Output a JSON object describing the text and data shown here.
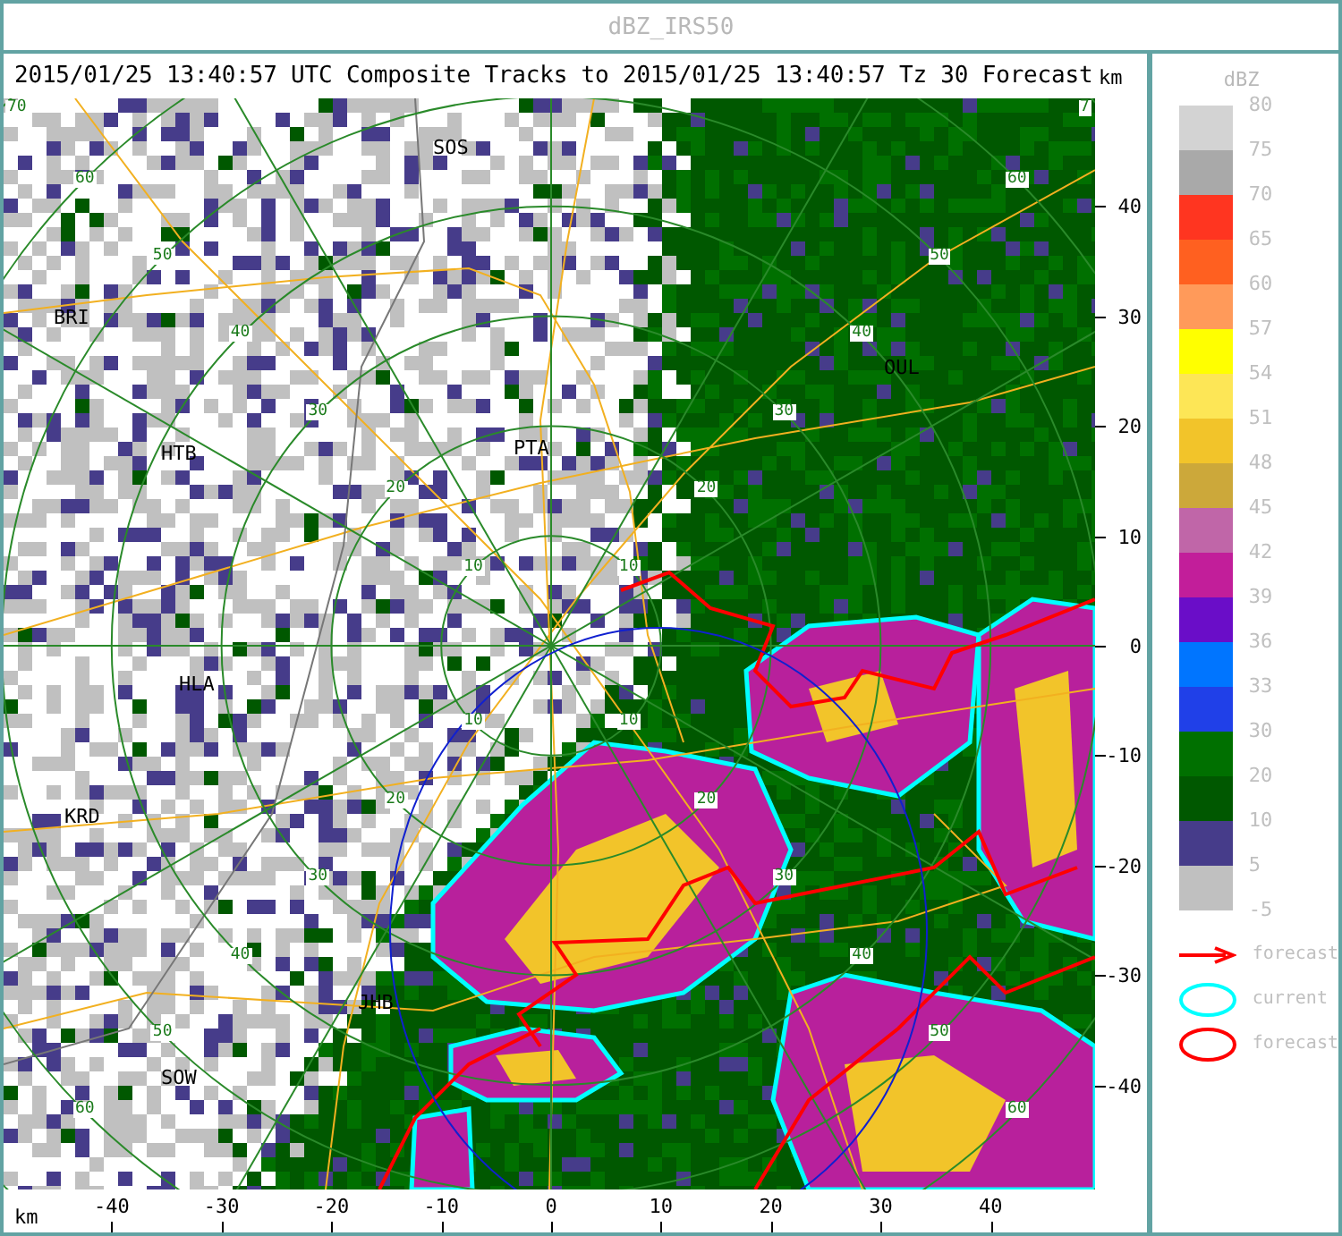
{
  "window": {
    "title": "dBZ_IRS50"
  },
  "header": "2015/01/25 13:40:57 UTC Composite Tracks to 2015/01/25 13:40:57 Tz 30 Forecast",
  "map": {
    "cities": [
      {
        "name": "SOS"
      },
      {
        "name": "BRI"
      },
      {
        "name": "HTB"
      },
      {
        "name": "PTA"
      },
      {
        "name": "OUL"
      },
      {
        "name": "HLA"
      },
      {
        "name": "KRD"
      },
      {
        "name": "JHB"
      },
      {
        "name": "SOW"
      }
    ],
    "ring_labels": [
      {
        "kind": "nw",
        "labels": [
          "10",
          "20",
          "30",
          "40",
          "50",
          "60",
          "70"
        ]
      },
      {
        "kind": "ne",
        "labels": [
          "10",
          "20",
          "30",
          "40",
          "50",
          "60",
          "7"
        ]
      },
      {
        "kind": "sw",
        "labels": [
          "10",
          "20",
          "30",
          "40",
          "50",
          "60"
        ]
      },
      {
        "kind": "se",
        "labels": [
          "10",
          "20",
          "30",
          "40",
          "50",
          "60"
        ]
      }
    ]
  },
  "y_axis": {
    "unit": "km",
    "ticks": [
      "40",
      "30",
      "20",
      "10",
      "0",
      "-10",
      "-20",
      "-30",
      "-40"
    ]
  },
  "x_axis": {
    "unit": "km",
    "ticks": [
      "-40",
      "-30",
      "-20",
      "-10",
      "0",
      "10",
      "20",
      "30",
      "40"
    ]
  },
  "legend": {
    "title": "dBZ",
    "top_label": "80",
    "bins": [
      {
        "color": "#d3d3d3",
        "label": "75"
      },
      {
        "color": "#a9a9a9",
        "label": "70"
      },
      {
        "color": "#ff3520",
        "label": "65"
      },
      {
        "color": "#ff6020",
        "label": "60"
      },
      {
        "color": "#ff9a5a",
        "label": "57"
      },
      {
        "color": "#ffff00",
        "label": "54"
      },
      {
        "color": "#fde656",
        "label": "51"
      },
      {
        "color": "#f2c42a",
        "label": "48"
      },
      {
        "color": "#cca83a",
        "label": "45"
      },
      {
        "color": "#c066a8",
        "label": "42"
      },
      {
        "color": "#c21e9a",
        "label": "39"
      },
      {
        "color": "#6a0dc8",
        "label": "36"
      },
      {
        "color": "#0075ff",
        "label": "33"
      },
      {
        "color": "#2040e8",
        "label": "30"
      },
      {
        "color": "#007000",
        "label": "20"
      },
      {
        "color": "#005800",
        "label": "10"
      },
      {
        "color": "#463c8a",
        "label": "5"
      },
      {
        "color": "#c0c0c0",
        "label": "-5"
      }
    ],
    "keys": [
      {
        "kind": "arrow",
        "label": "forecast"
      },
      {
        "kind": "current",
        "label": "current"
      },
      {
        "kind": "outline",
        "label": "forecast"
      }
    ]
  }
}
